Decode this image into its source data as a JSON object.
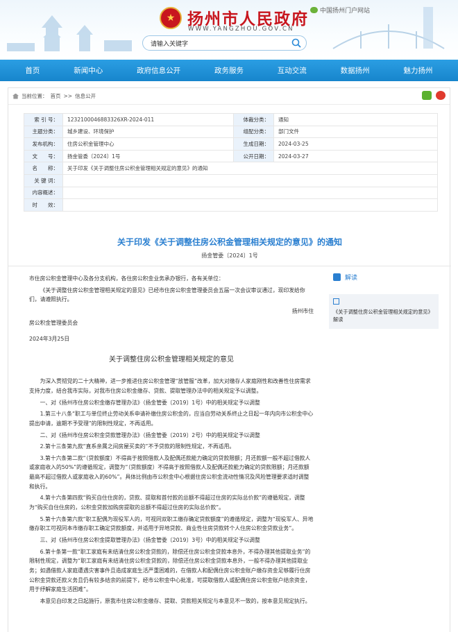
{
  "header": {
    "site_title": "扬州市人民政府",
    "site_url": "WWW.YANGZHOU.GOV.CN",
    "portal_label": "中国扬州门户网站",
    "search_placeholder": "请输入关键字"
  },
  "nav": [
    "首页",
    "新闻中心",
    "政府信息公开",
    "政务服务",
    "互动交流",
    "数据扬州",
    "魅力扬州"
  ],
  "breadcrumb": {
    "current_label": "当前位置：",
    "home": "首页",
    "sep": ">>",
    "section": "信息公开"
  },
  "meta": {
    "index_label": "索 引 号：",
    "index_value": "1232100046883326XR-2024-011",
    "genre_label": "体裁分类：",
    "genre_value": "通知",
    "topic_label": "主题分类：",
    "topic_value": "城乡建设、环境保护",
    "org_type_label": "组配分类：",
    "org_type_value": "部门文件",
    "issuer_label": "发布机构：",
    "issuer_value": "住房公积金管理中心",
    "created_label": "生成日期：",
    "created_value": "2024-03-25",
    "docno_label": "文　　号：",
    "docno_value": "扬金管委〔2024〕1号",
    "public_label": "公开日期：",
    "public_value": "2024-03-27",
    "name_label": "名　　称：",
    "name_value": "关于印发《关于调整住房公积金管理相关规定的意见》的通知",
    "keywords_label": "关 键 词：",
    "keywords_value": "",
    "summary_label": "内容概述：",
    "summary_value": "",
    "effect_label": "时　　效：",
    "effect_value": ""
  },
  "doc": {
    "title": "关于印发《关于调整住房公积金管理相关规定的意见》的通知",
    "number": "扬金管委〔2024〕1号",
    "addressee": "市住房公积金管理中心及各分支机构，各住房公积金业务承办银行，各有关单位：",
    "intro": "《关于调整住房公积金管理相关规定的意见》已经市住房公积金管理委员会五届一次会议审议通过，现印发给你们，请遵照执行。",
    "sign_a": "扬州市住",
    "sign_b": "房公积金管理委员会",
    "date": "2024年3月25日",
    "subtitle": "关于调整住房公积金管理相关规定的意见",
    "paragraphs": [
      "为深入贯彻党的二十大精神，进一步推进住房公积金管理“放管服”改革，加大对缴存人家庭刚性和改善性住房需求支持力度，结合我市实际，对我市住房公积金缴存、贷款、提取管理办法中的相关规定予以调整。",
      "一、对《扬州市住房公积金缴存管理办法》（扬金管委〔2019〕1号）中的相关规定予以调整",
      "1.第三十八条“职工与单位终止劳动关系申请补缴住房公积金的，应当自劳动关系终止之日起一年内向市公积金中心提出申请，逾期不予受理”的限制性规定，不再适用。",
      "二、对《扬州市住房公积金贷款管理办法》（扬金管委〔2019〕2号）中的相关规定予以调整",
      "2.第十三条第九款“直系亲属之间房屋买卖的”不予贷款的限制性规定，不再适用。",
      "3.第十六条第二款“（贷款额度）不得高于按照借款人及配偶还款能力确定的贷款限额；月还款额一般不超过借款人或家庭收入的50%”的遵循规定，调整为“（贷款额度）不得高于按照借款人及配偶还款能力确定的贷款限额；月还款额最高不超过借款人或家庭收入的60%”。具体比例由市公积金中心根据住房公积金流动性情况及风险管理要求适时调整和执行。",
      "4.第十六条第四款“购买自住住房的，贷款、提取和首付款的总额不得超过住房的实际总价款”的遵循规定，调整为“购买自住住房的，公积金贷款加购房提取的总额不得超过住房的实际总价款”。",
      "5.第十六条第六款“职工配偶为现役军人的，可视同双职工缴存确定贷款额度”的遵循规定，调整为“现役军人、异地缴存职工可视同本市缴存职工确定贷款额度，并适用于异地贷款、商业性住房贷款转个人住房公积金贷款业务”。",
      "三、对《扬州市住房公积金提取管理办法》（扬金管委〔2019〕3号）中的相关规定予以调整",
      "6.第十条第一款“职工家庭有未结清住房公积金贷款的，除偿还住房公积金贷款本息外，不得办理其他提取业务”的限制性规定，调整为“职工家庭有未结清住房公积金贷款的，除偿还住房公积金贷款本息外，一般不得办理其他提取业务；如遇借款人家庭遭遇灾害事件且造成家庭生活严重困难的，在借款人和配偶住房公积金账户缴存资金足够履行住房公积金贷款还款义务且仍有较多结余的前提下，经市公积金中心批准，可提取借款人或配偶住房公积金账户结余资金，用于纾解家庭生活困难”。",
      "本意见自印发之日起施行，原我市住房公积金缴存、提取、贷款相关规定与本意见不一致的，按本意见规定执行。"
    ]
  },
  "side": {
    "head": "解读",
    "link": "《关于调整住房公积金管理相关规定的意见》解读"
  },
  "colors": {
    "brand_red": "#c8161e",
    "nav_blue": "#1b8fd6",
    "link_blue": "#2a7fd0"
  }
}
